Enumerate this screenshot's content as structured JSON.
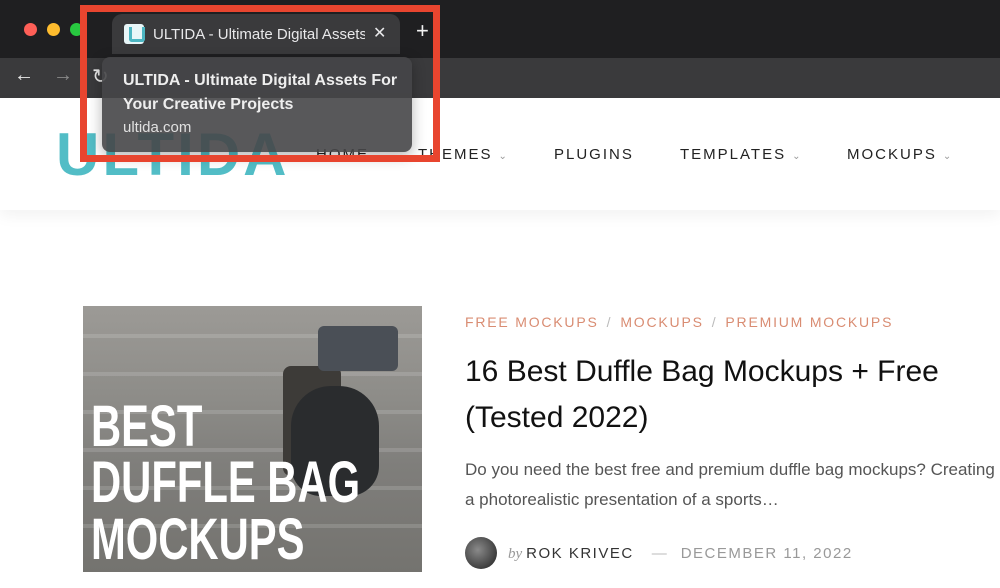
{
  "browser": {
    "tab": {
      "title": "ULTIDA - Ultimate Digital Assets",
      "close_glyph": "✕",
      "favicon": "ultida-favicon-icon"
    },
    "new_tab_glyph": "+",
    "nav": {
      "back_glyph": "←",
      "forward_glyph": "→",
      "reload_glyph": "↻"
    },
    "tooltip": {
      "title": "ULTIDA - Ultimate Digital Assets For Your Creative Projects",
      "url": "ultida.com"
    }
  },
  "site": {
    "logo": "ULTIDA",
    "nav": [
      {
        "label": "HOME"
      },
      {
        "label": "THEMES",
        "chevron": "⌄"
      },
      {
        "label": "PLUGINS"
      },
      {
        "label": "TEMPLATES",
        "chevron": "⌄"
      },
      {
        "label": "MOCKUPS",
        "chevron": "⌄"
      }
    ]
  },
  "post": {
    "thumbnail_lines": [
      "BEST",
      "DUFFLE BAG",
      "MOCKUPS"
    ],
    "categories": [
      "FREE MOCKUPS",
      "MOCKUPS",
      "PREMIUM MOCKUPS"
    ],
    "category_separator": "/",
    "title": "16 Best Duffle Bag Mockups + Free (Tested 2022)",
    "excerpt": "Do you need the best free and premium duffle bag mockups? Creating a photorealistic presentation of a sports…",
    "by": "by",
    "author": "ROK KRIVEC",
    "dash": "—",
    "date": "DECEMBER 11, 2022"
  },
  "colors": {
    "accent_teal": "#52bdc6",
    "category_orange": "#d98c72",
    "highlight_red": "#e8452f"
  }
}
